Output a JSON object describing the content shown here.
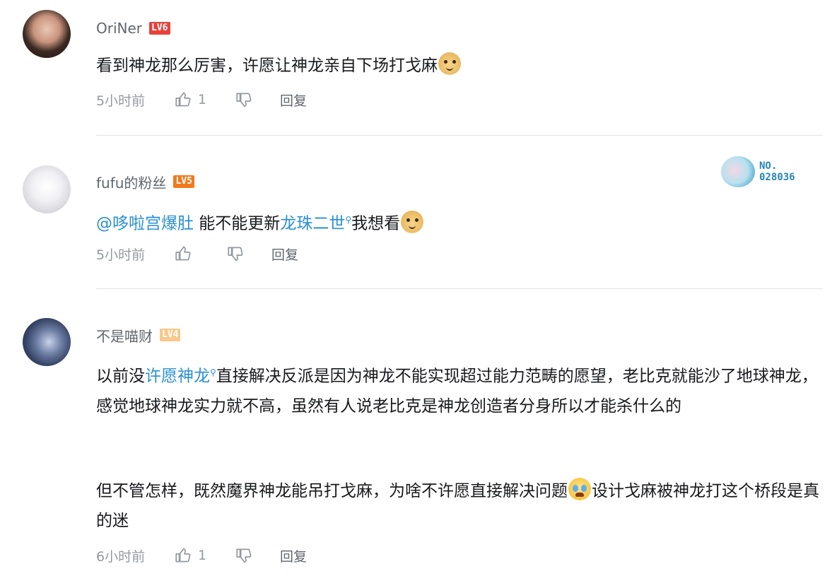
{
  "comments": [
    {
      "username": "OriNer",
      "level": "LV6",
      "text_parts": [
        "看到神龙那么厉害，许愿让神龙亲自下场打戈麻"
      ],
      "time": "5小时前",
      "likes": "1",
      "reply_label": "回复",
      "avatar_color": "#3b2a22"
    },
    {
      "username": "fufu的粉丝",
      "level": "LV5",
      "mention": "@哆啦宫爆肚",
      "text_before_link": " 能不能更新",
      "link": "龙珠二世",
      "text_after_link": "我想看",
      "time": "5小时前",
      "likes": "",
      "reply_label": "回复",
      "fan_badge_number": "NO.\n028036",
      "avatar_color": "#e8e8ec"
    },
    {
      "username": "不是喵财",
      "level": "LV4",
      "text_prefix": "以前没",
      "link": "许愿神龙",
      "text_after_link": "直接解决反派是因为神龙不能实现超过能力范畴的愿望，老比克就能沙了地球神龙，感觉地球神龙实力就不高，虽然有人说老比克是神龙创造者分身所以才能杀什么的",
      "text_para2_before_emoji": "但不管怎样，既然魔界神龙能吊打戈麻，为啥不许愿直接解决问题",
      "text_para2_after_emoji": "设计戈麻被神龙打这个桥段是真的迷",
      "time": "6小时前",
      "likes": "1",
      "reply_label": "回复",
      "avatar_color": "#4a5a7a"
    }
  ],
  "colors": {
    "link": "#2a8fd4",
    "meta": "#9499a0",
    "username": "#61666d",
    "divider": "#e3e5e7"
  },
  "icons": [
    "thumbs-up-icon",
    "thumbs-down-icon",
    "search-icon",
    "doge-emoji",
    "crying-emoji"
  ]
}
